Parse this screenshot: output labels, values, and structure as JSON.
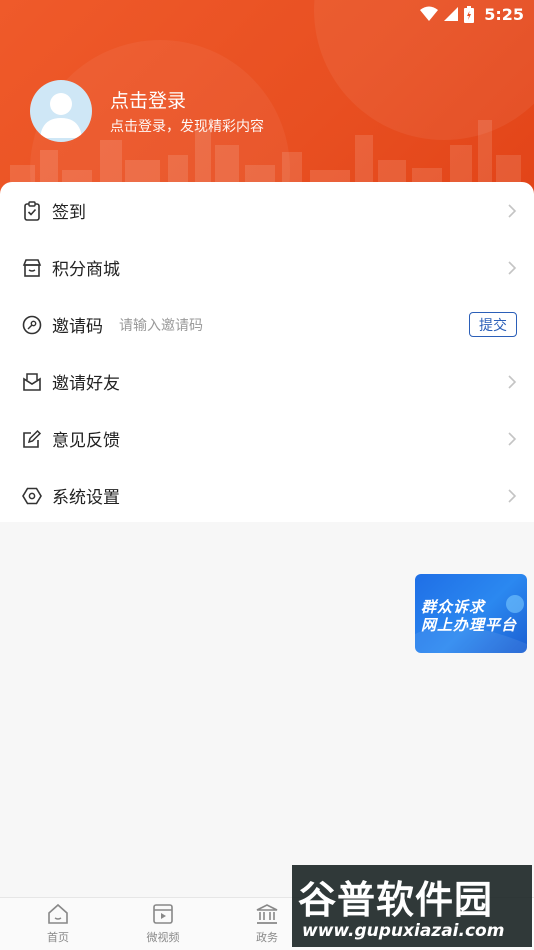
{
  "status_bar": {
    "time": "5:25"
  },
  "header": {
    "login_title": "点击登录",
    "login_subtitle": "点击登录，发现精彩内容"
  },
  "menu": {
    "items": [
      {
        "label": "签到",
        "icon": "clipboard-check-icon"
      },
      {
        "label": "积分商城",
        "icon": "shop-icon"
      },
      {
        "label": "邀请码",
        "icon": "key-icon",
        "placeholder": "请输入邀请码",
        "submit": "提交"
      },
      {
        "label": "邀请好友",
        "icon": "mail-icon"
      },
      {
        "label": "意见反馈",
        "icon": "edit-icon"
      },
      {
        "label": "系统设置",
        "icon": "hexagon-settings-icon"
      }
    ]
  },
  "float_banner": {
    "line1": "群众诉求",
    "line2": "网上办理平台"
  },
  "bottom_nav": {
    "items": [
      {
        "label": "首页",
        "icon": "home-icon"
      },
      {
        "label": "微视频",
        "icon": "video-icon"
      },
      {
        "label": "政务",
        "icon": "government-icon"
      }
    ]
  },
  "watermark": {
    "title": "谷普软件园",
    "url": "www.gupuxiazai.com"
  },
  "colors": {
    "header": "#ea5224",
    "accent_blue": "#2b5fb8",
    "banner_blue": "#2079ea"
  }
}
